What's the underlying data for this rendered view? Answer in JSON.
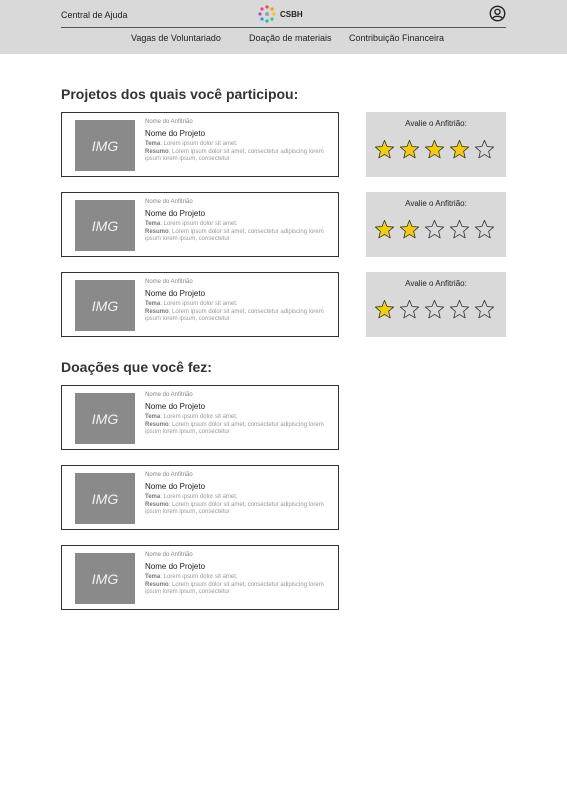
{
  "header": {
    "help_label": "Central de Ajuda",
    "logo_text": "CSBH",
    "nav": [
      "Vagas de Voluntariado",
      "Doação de materiais",
      "Contribuição Financeira"
    ]
  },
  "sections": {
    "projects_title": "Projetos dos quais você participou:",
    "donations_title": "Doações que você fez:"
  },
  "card": {
    "img_label": "IMG",
    "host_label": "Nome do Anfitrião",
    "project_label": "Nome do Projeto",
    "theme_key": "Tema",
    "theme_text": ": Lorem ipsum dolor sit amet.",
    "summary_key": "Resumo",
    "summary_text": ": Lorem ipsum dolor sit amet, consectetur adipiscing lorem ipsum lorem ipsum, consectetur"
  },
  "rating_label": "Avalie o Anfitrião:",
  "ratings": [
    4,
    2,
    1
  ],
  "colors": {
    "star_fill": "#f5cc0a",
    "star_stroke": "#333333",
    "panel": "#d9d9d9"
  }
}
